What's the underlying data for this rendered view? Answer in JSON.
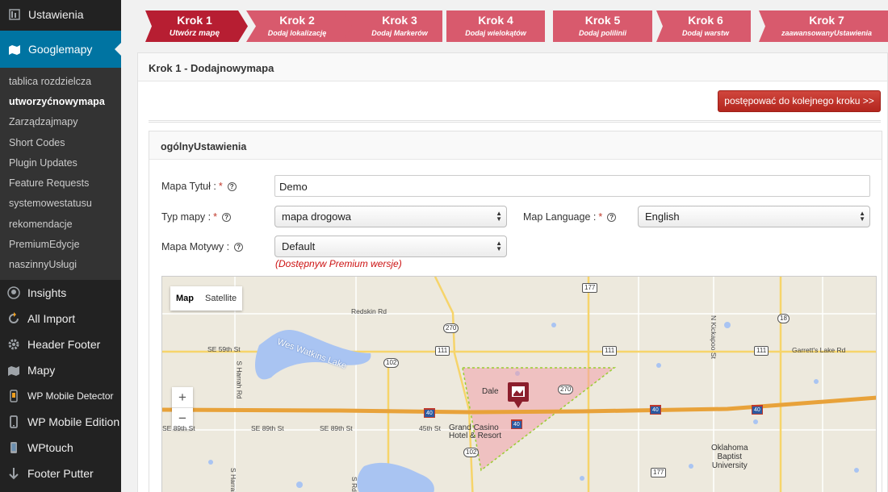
{
  "sidebar": {
    "top_label": "Ustawienia",
    "active_label": "Googlemapy",
    "sub_items": [
      {
        "label": "tablica rozdzielcza"
      },
      {
        "label": "utworzyćnowymapa"
      },
      {
        "label": "Zarządzajmapy"
      },
      {
        "label": "Short Codes"
      },
      {
        "label": "Plugin Updates"
      },
      {
        "label": "Feature Requests"
      },
      {
        "label": "systemowestatusu"
      },
      {
        "label": "rekomendacje"
      },
      {
        "label": "PremiumEdycje"
      },
      {
        "label": "naszinnyUsługi"
      }
    ],
    "items": [
      {
        "label": "Insights",
        "icon": "insights-icon"
      },
      {
        "label": "All Import",
        "icon": "import-icon"
      },
      {
        "label": "Header Footer",
        "icon": "gear-icon"
      },
      {
        "label": "Mapy",
        "icon": "map-icon"
      },
      {
        "label": "WP Mobile Detector",
        "icon": "mobile-icon"
      },
      {
        "label": "WP Mobile Edition",
        "icon": "phone-icon"
      },
      {
        "label": "WPtouch",
        "icon": "device-icon"
      },
      {
        "label": "Footer Putter",
        "icon": "arrow-down-icon"
      }
    ]
  },
  "steps": [
    {
      "title": "Krok 1",
      "subtitle": "Utwórz mapę"
    },
    {
      "title": "Krok 2",
      "subtitle": "Dodaj lokalizację"
    },
    {
      "title": "Krok 3",
      "subtitle": "Dodaj Markerów"
    },
    {
      "title": "Krok 4",
      "subtitle": "Dodaj wielokątów"
    },
    {
      "title": "Krok 5",
      "subtitle": "Dodaj polilinii"
    },
    {
      "title": "Krok 6",
      "subtitle": "Dodaj warstw"
    },
    {
      "title": "Krok 7",
      "subtitle": "zaawansowanyUstawienia"
    }
  ],
  "card": {
    "title": "Krok 1 - Dodajnowymapa",
    "next_button": "postępować  do kolejnego kroku >>"
  },
  "general": {
    "title": "ogólnyUstawienia",
    "map_title_label": "Mapa Tytuł :",
    "map_title_value": "Demo",
    "map_type_label": "Typ mapy :",
    "map_type_value": "mapa drogowa",
    "map_language_label": "Map Language :",
    "map_language_value": "English",
    "map_theme_label": "Mapa Motywy :",
    "map_theme_value": "Default",
    "premium_note": "(Dostępnyw Premium wersje)",
    "required_mark": "*",
    "help_glyph": "?"
  },
  "map": {
    "type_map": "Map",
    "type_satellite": "Satellite",
    "zoom_in": "+",
    "zoom_out": "−",
    "labels": {
      "redskin": "Redskin Rd",
      "se59": "SE 59th St",
      "lake": "Wes Watkins Lake",
      "harrah": "S Harrah Rd",
      "se89a": "SE 89th St",
      "se89b": "SE 89th St",
      "s45": "45th St",
      "se_extra": "SE 89th St",
      "dale": "Dale",
      "grand": "Grand Casino\nHotel & Resort",
      "garrett": "Garrett's Lake Rd",
      "kickapoo": "N Kickapoo St",
      "okbu": "Oklahoma\nBaptist\nUniversity",
      "harrah2": "S Harrah Rd",
      "s_road": "S Rd"
    },
    "shields": {
      "r177a": "177",
      "r270a": "270",
      "r111a": "111",
      "r111b": "111",
      "r111c": "111",
      "r102a": "102",
      "r270b": "270",
      "r18": "18",
      "r102b": "102",
      "r177b": "177",
      "i40a": "40",
      "i40b": "40",
      "i40c": "40",
      "i40d": "40"
    }
  }
}
